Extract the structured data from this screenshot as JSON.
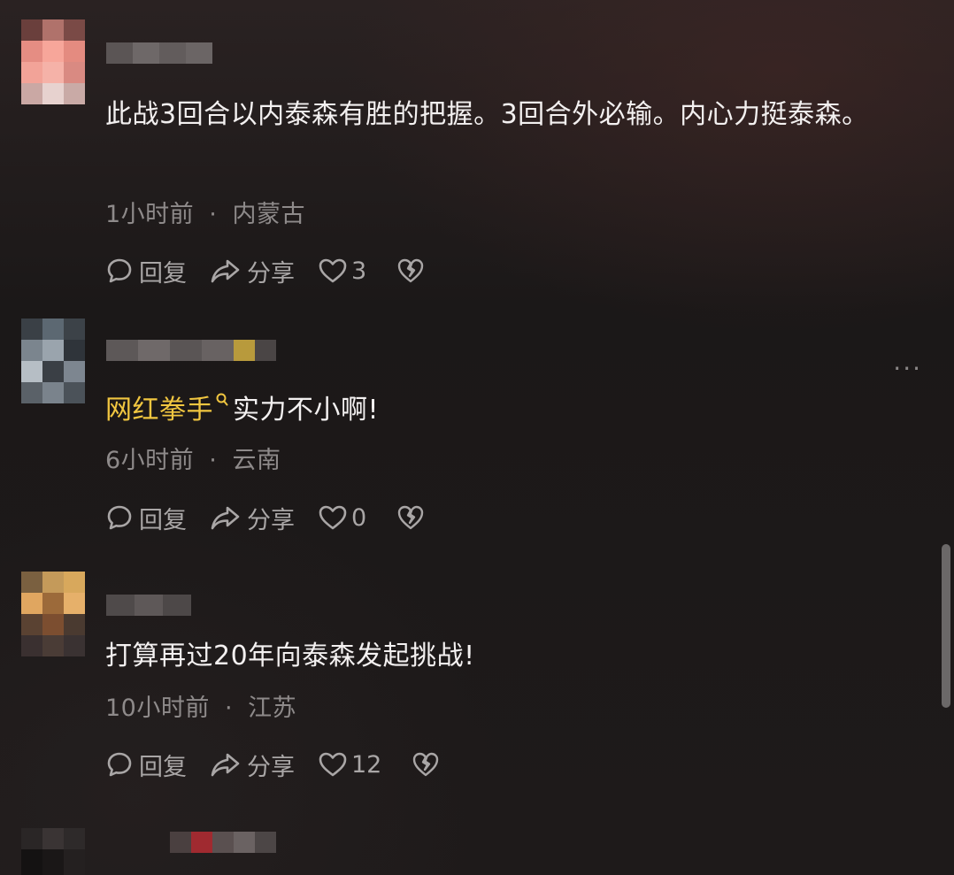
{
  "comments": [
    {
      "text": "此战3回合以内泰森有胜的把握。3回合外必输。内心力挺泰森。",
      "time": "1小时前",
      "location": "内蒙古",
      "reply_label": "回复",
      "share_label": "分享",
      "likes": "3"
    },
    {
      "tag": "网红拳手",
      "text": "实力不小啊!",
      "time": "6小时前",
      "location": "云南",
      "reply_label": "回复",
      "share_label": "分享",
      "likes": "0"
    },
    {
      "text": "打算再过20年向泰森发起挑战!",
      "time": "10小时前",
      "location": "江苏",
      "reply_label": "回复",
      "share_label": "分享",
      "likes": "12"
    }
  ],
  "meta_separator": "·",
  "more_label": "···",
  "icons": {
    "reply": "comment-bubble-icon",
    "share": "share-arrow-icon",
    "like": "heart-outline-icon",
    "dislike": "broken-heart-icon",
    "tag_search": "search-icon",
    "more": "more-dots-icon"
  },
  "colors": {
    "background": "#1c1818",
    "text": "#f3f0f0",
    "meta": "#8e8a8a",
    "action": "#a9a6a6",
    "tag": "#f1c640"
  }
}
